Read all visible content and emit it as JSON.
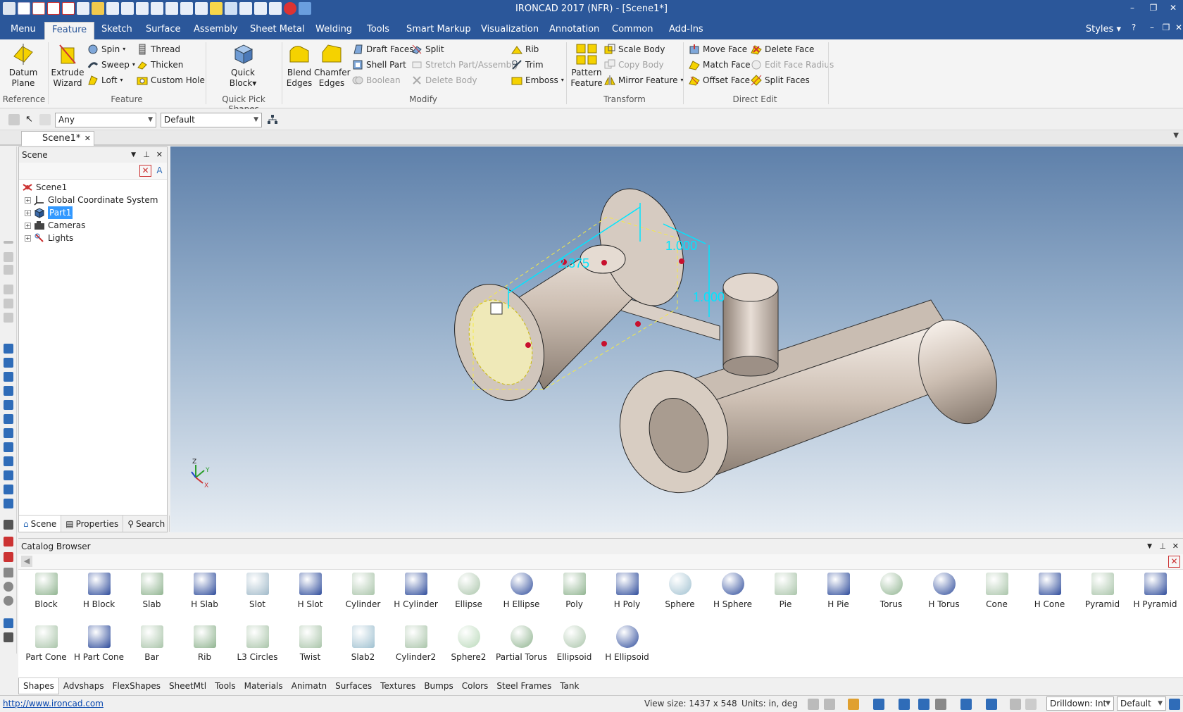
{
  "window": {
    "title": "IRONCAD 2017 (NFR) - [Scene1*]"
  },
  "ribbon_tabs": [
    "Menu",
    "Feature",
    "Sketch",
    "Surface",
    "Assembly",
    "Sheet Metal",
    "Welding",
    "Tools",
    "Smart Markup",
    "Visualization",
    "Annotation",
    "Common",
    "Add-Ins"
  ],
  "active_ribbon_tab": "Feature",
  "styles_label": "Styles",
  "ribbon": {
    "reference": {
      "label": "Reference",
      "datum_plane": "Datum\nPlane"
    },
    "feature": {
      "label": "Feature",
      "extrude_wizard": "Extrude\nWizard",
      "spin": "Spin",
      "sweep": "Sweep",
      "loft": "Loft",
      "thread": "Thread",
      "thicken": "Thicken",
      "custom_hole": "Custom Hole"
    },
    "quick_pick": {
      "label": "Quick Pick Shapes",
      "quick_block": "Quick\nBlock"
    },
    "modify": {
      "label": "Modify",
      "blend_edges": "Blend\nEdges",
      "chamfer_edges": "Chamfer\nEdges",
      "draft_faces": "Draft Faces",
      "shell_part": "Shell Part",
      "boolean": "Boolean",
      "split": "Split",
      "stretch": "Stretch Part/Assembly",
      "delete_body": "Delete Body",
      "rib": "Rib",
      "trim": "Trim",
      "emboss": "Emboss"
    },
    "transform": {
      "label": "Transform",
      "pattern_feature": "Pattern\nFeature",
      "scale_body": "Scale Body",
      "copy_body": "Copy Body",
      "mirror_feature": "Mirror Feature"
    },
    "direct_edit": {
      "label": "Direct Edit",
      "move_face": "Move Face",
      "match_face": "Match Face",
      "offset_face": "Offset Face",
      "delete_face": "Delete Face",
      "edit_face_radius": "Edit Face Radius",
      "split_faces": "Split Faces"
    }
  },
  "toolbar": {
    "filter_value": "Any",
    "style_value": "Default"
  },
  "doc_tab": "Scene1*",
  "scene_panel": {
    "title": "Scene",
    "tree": [
      {
        "label": "Scene1",
        "level": 0,
        "expandable": false,
        "selected": false
      },
      {
        "label": "Global Coordinate System",
        "level": 1,
        "expandable": true,
        "selected": false
      },
      {
        "label": "Part1",
        "level": 1,
        "expandable": true,
        "selected": true
      },
      {
        "label": "Cameras",
        "level": 1,
        "expandable": true,
        "selected": false
      },
      {
        "label": "Lights",
        "level": 1,
        "expandable": true,
        "selected": false
      }
    ],
    "bottom_tabs": [
      "Scene",
      "Properties",
      "Search"
    ]
  },
  "viewport": {
    "dimensions": [
      "2.375",
      "1.000",
      "1.000"
    ],
    "axis_labels": [
      "Z",
      "Y",
      "X"
    ]
  },
  "catalog": {
    "title": "Catalog Browser",
    "shapes": [
      "Block",
      "H Block",
      "Slab",
      "H Slab",
      "Slot",
      "H Slot",
      "Cylinder",
      "H Cylinder",
      "Ellipse",
      "H Ellipse",
      "Poly",
      "H Poly",
      "Sphere",
      "H Sphere",
      "Pie",
      "H Pie",
      "Torus",
      "H Torus",
      "Cone",
      "H Cone",
      "Pyramid",
      "H Pyramid",
      "Part Cone",
      "H Part Cone",
      "Bar",
      "Rib",
      "L3 Circles",
      "Twist",
      "Slab2",
      "Cylinder2",
      "Sphere2",
      "Partial Torus",
      "Ellipsoid",
      "H Ellipsoid"
    ],
    "tabs": [
      "Shapes",
      "Advshaps",
      "FlexShapes",
      "SheetMtl",
      "Tools",
      "Materials",
      "Animatn",
      "Surfaces",
      "Textures",
      "Bumps",
      "Colors",
      "Steel Frames",
      "Tank"
    ],
    "active_tab": "Shapes"
  },
  "status": {
    "url": "http://www.ironcad.com",
    "view_size": "View size: 1437 x  548",
    "units": "Units: in, deg",
    "drilldown": "Drilldown: Int",
    "style": "Default"
  },
  "colors": {
    "titlebar": "#2b579a",
    "selection": "#3399ff",
    "dimension": "#00e5ff"
  }
}
